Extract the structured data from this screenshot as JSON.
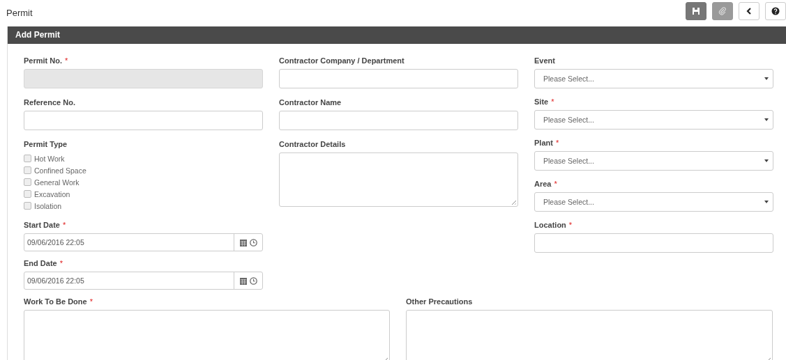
{
  "page": {
    "title": "Permit"
  },
  "toolbar": [
    {
      "kind": "save",
      "disabled": false
    },
    {
      "kind": "attach",
      "disabled": true
    },
    {
      "kind": "back",
      "disabled": false
    },
    {
      "kind": "help",
      "disabled": false
    }
  ],
  "panel": {
    "title": "Add Permit"
  },
  "columns": [
    [
      {
        "kind": "text",
        "label": "Permit No.",
        "mark": "*",
        "disabled": true
      },
      {
        "kind": "text",
        "label": "Reference No.",
        "disabled": false
      },
      {
        "kind": "checks",
        "label": "Permit Type",
        "options": [
          {
            "label": "Hot Work",
            "checked": false
          },
          {
            "label": "Confined Space",
            "checked": false
          },
          {
            "label": "General Work",
            "checked": false
          },
          {
            "label": "Excavation",
            "checked": false
          },
          {
            "label": "Isolation",
            "checked": false
          }
        ]
      },
      {
        "kind": "datetime",
        "label": "Start Date",
        "mark": "*",
        "value": "09/06/2016 22:05"
      },
      {
        "kind": "datetime",
        "label": "End Date",
        "mark": "*",
        "value": "09/06/2016 22:05"
      }
    ],
    [
      {
        "kind": "text",
        "label": "Contractor Company / Department",
        "disabled": false
      },
      {
        "kind": "text",
        "label": "Contractor Name",
        "disabled": false
      },
      {
        "kind": "textarea",
        "label": "Contractor Details"
      }
    ],
    [
      {
        "kind": "select",
        "label": "Event",
        "placeholder": "Please Select..."
      },
      {
        "kind": "select",
        "label": "Site",
        "mark": "*",
        "placeholder": "Please Select..."
      },
      {
        "kind": "select",
        "label": "Plant",
        "mark": "*",
        "placeholder": "Please Select..."
      },
      {
        "kind": "select",
        "label": "Area",
        "mark": "*",
        "placeholder": "Please Select..."
      },
      {
        "kind": "text",
        "label": "Location",
        "mark": "*",
        "disabled": false
      }
    ]
  ],
  "bottom": [
    {
      "kind": "textarea",
      "label": "Work To Be Done",
      "mark": "*"
    },
    {
      "kind": "textarea",
      "label": "Other Precautions"
    }
  ]
}
